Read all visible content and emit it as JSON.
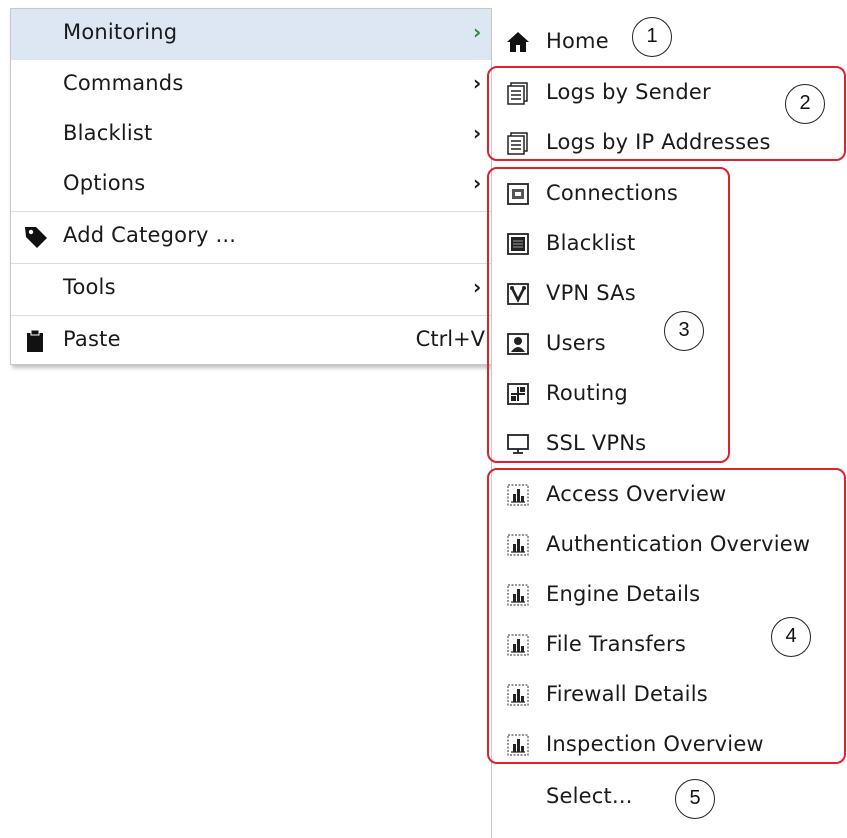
{
  "main_menu": {
    "items": [
      {
        "label": "Monitoring",
        "has_submenu": true,
        "highlighted": true
      },
      {
        "label": "Commands",
        "has_submenu": true
      },
      {
        "label": "Blacklist",
        "has_submenu": true
      },
      {
        "label": "Options",
        "has_submenu": true
      },
      {
        "label": "Add Category ...",
        "icon": "tag-icon"
      },
      {
        "label": "Tools",
        "has_submenu": true
      },
      {
        "label": "Paste",
        "icon": "clipboard-icon",
        "shortcut": "Ctrl+V"
      }
    ],
    "submenu_arrow": "›"
  },
  "submenu": {
    "items": [
      {
        "label": "Home",
        "icon": "home-icon"
      },
      {
        "label": "Logs by Sender",
        "icon": "logs-icon"
      },
      {
        "label": "Logs by IP Addresses",
        "icon": "logs-icon"
      },
      {
        "label": "Connections",
        "icon": "connections-icon"
      },
      {
        "label": "Blacklist",
        "icon": "blacklist-icon"
      },
      {
        "label": "VPN SAs",
        "icon": "vpn-sa-icon"
      },
      {
        "label": "Users",
        "icon": "user-icon"
      },
      {
        "label": "Routing",
        "icon": "routing-icon"
      },
      {
        "label": "SSL VPNs",
        "icon": "monitor-icon"
      },
      {
        "label": "Access Overview",
        "icon": "report-chart-icon"
      },
      {
        "label": "Authentication Overview",
        "icon": "report-chart-icon"
      },
      {
        "label": "Engine Details",
        "icon": "report-chart-icon"
      },
      {
        "label": "File Transfers",
        "icon": "report-chart-icon"
      },
      {
        "label": "Firewall Details",
        "icon": "report-chart-icon"
      },
      {
        "label": "Inspection Overview",
        "icon": "report-chart-icon"
      },
      {
        "label": "Select..."
      }
    ]
  },
  "callouts": [
    "1",
    "2",
    "3",
    "4",
    "5"
  ],
  "colors": {
    "highlight": "#dce7f3",
    "callout_border": "#e0202a",
    "text": "#1a1a1a"
  }
}
